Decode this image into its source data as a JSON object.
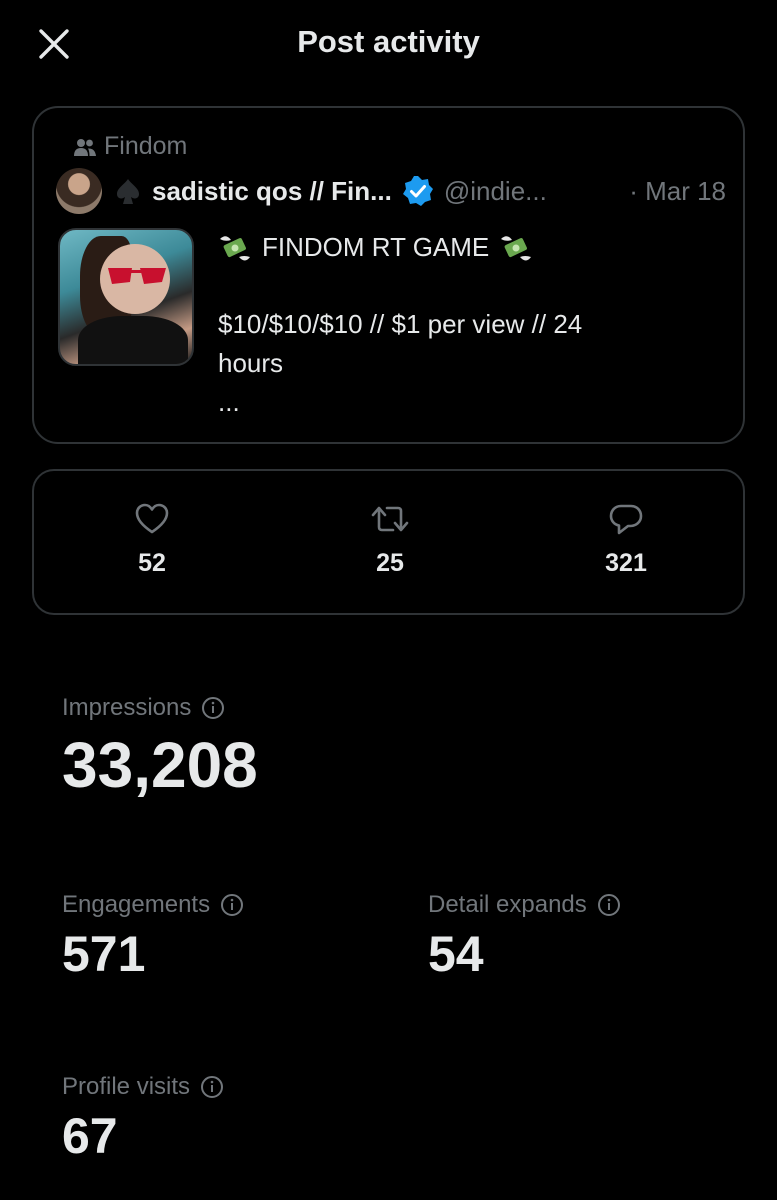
{
  "header": {
    "title": "Post activity"
  },
  "post": {
    "community": "Findom",
    "display_name": "sadistic qos // Fin...",
    "handle": "@indie...",
    "date": "· Mar 18",
    "text_line1": "FINDOM RT GAME",
    "text_line2": "$10/$10/$10 // $1 per view // 24",
    "text_line3": "hours",
    "text_more": "..."
  },
  "stats": {
    "likes": "52",
    "reposts": "25",
    "replies": "321"
  },
  "metrics": {
    "impressions_label": "Impressions",
    "impressions_value": "33,208",
    "engagements_label": "Engagements",
    "engagements_value": "571",
    "detail_expands_label": "Detail expands",
    "detail_expands_value": "54",
    "profile_visits_label": "Profile visits",
    "profile_visits_value": "67"
  },
  "icons": {
    "close": "close-icon",
    "community": "people-icon",
    "verified": "verified-badge-icon",
    "like": "heart-icon",
    "repost": "repost-icon",
    "reply": "reply-icon",
    "info": "info-icon",
    "money": "money-with-wings-icon"
  },
  "colors": {
    "background": "#000000",
    "text_primary": "#e7e9ea",
    "text_secondary": "#71767b",
    "border": "#2f3336",
    "verified": "#1d9bf0"
  }
}
